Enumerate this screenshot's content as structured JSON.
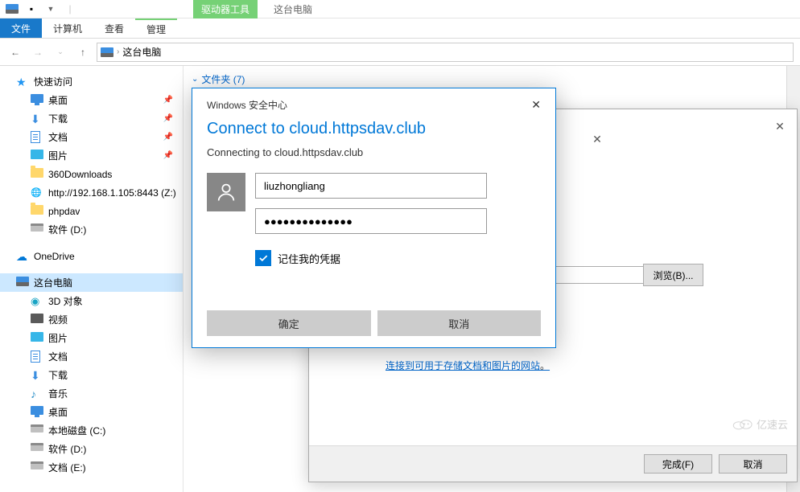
{
  "titlebar": {
    "drive_tools": "驱动器工具",
    "app_title": "这台电脑"
  },
  "ribbon": {
    "file": "文件",
    "computer": "计算机",
    "view": "查看",
    "manage": "管理"
  },
  "addressbar": {
    "location": "这台电脑"
  },
  "sidebar": {
    "quick_access": "快速访问",
    "items_qa": [
      {
        "label": "桌面",
        "icon": "desktop",
        "pin": true
      },
      {
        "label": "下载",
        "icon": "download",
        "pin": true
      },
      {
        "label": "文档",
        "icon": "doc",
        "pin": true
      },
      {
        "label": "图片",
        "icon": "pic",
        "pin": true
      },
      {
        "label": "360Downloads",
        "icon": "folder",
        "pin": false
      },
      {
        "label": "http://192.168.1.105:8443 (Z:)",
        "icon": "net",
        "pin": false
      },
      {
        "label": "phpdav",
        "icon": "folder",
        "pin": false
      },
      {
        "label": "软件 (D:)",
        "icon": "drive",
        "pin": false
      }
    ],
    "onedrive": "OneDrive",
    "thispc": "这台电脑",
    "items_pc": [
      {
        "label": "3D 对象",
        "icon": "3d"
      },
      {
        "label": "视频",
        "icon": "video"
      },
      {
        "label": "图片",
        "icon": "pic"
      },
      {
        "label": "文档",
        "icon": "doc"
      },
      {
        "label": "下载",
        "icon": "download"
      },
      {
        "label": "音乐",
        "icon": "music"
      },
      {
        "label": "桌面",
        "icon": "desktop"
      },
      {
        "label": "本地磁盘 (C:)",
        "icon": "drive"
      },
      {
        "label": "软件 (D:)",
        "icon": "drive"
      },
      {
        "label": "文档 (E:)",
        "icon": "drive"
      }
    ]
  },
  "content": {
    "folders_header": "文件夹 (7)"
  },
  "wizard": {
    "browse": "浏览(B)...",
    "link": "连接到可用于存储文档和图片的网站",
    "finish": "完成(F)",
    "cancel": "取消"
  },
  "cred": {
    "title": "Windows 安全中心",
    "heading": "Connect to cloud.httpsdav.club",
    "sub": "Connecting to cloud.httpsdav.club",
    "username": "liuzhongliang",
    "password": "●●●●●●●●●●●●●●",
    "remember": "记住我的凭据",
    "ok": "确定",
    "cancel": "取消"
  },
  "watermark": "亿速云"
}
